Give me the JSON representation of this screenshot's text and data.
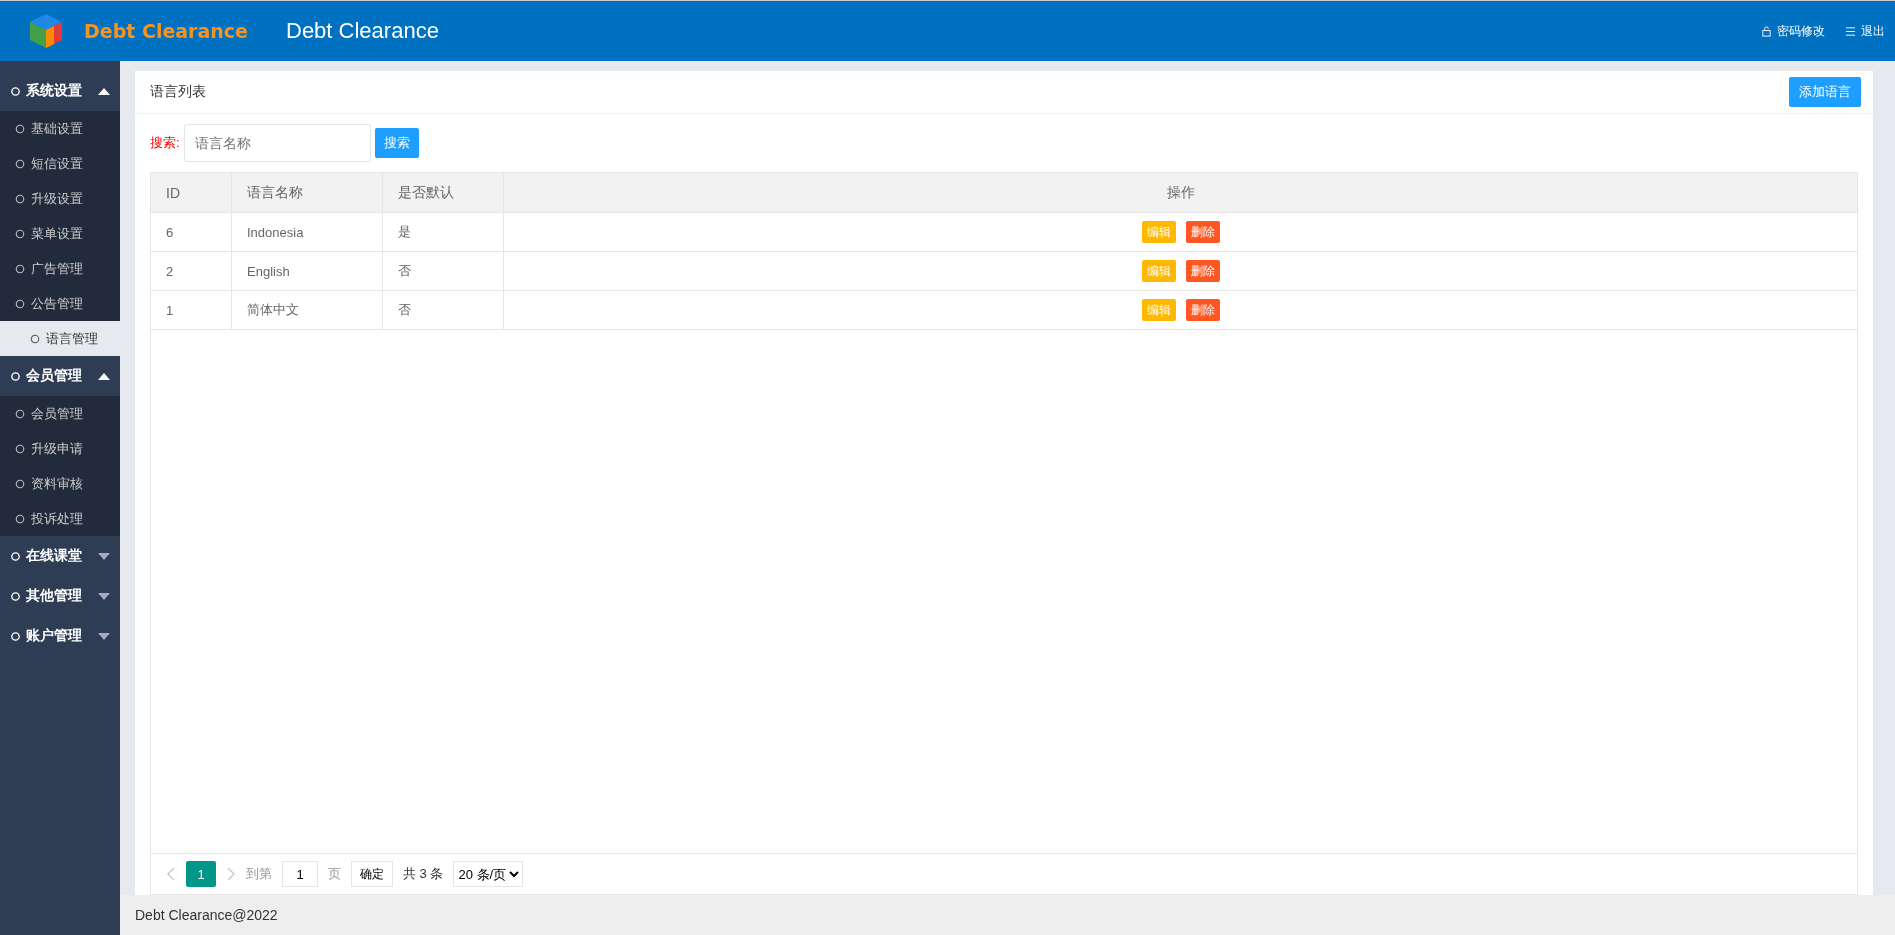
{
  "header": {
    "logo_text": "Debt Clearance",
    "title": "Debt Clearance",
    "links": [
      "密码修改",
      "退出"
    ]
  },
  "sidebar": {
    "groups": [
      {
        "label": "系统设置",
        "expanded": true,
        "items": [
          {
            "label": "基础设置",
            "selected": false
          },
          {
            "label": "短信设置",
            "selected": false
          },
          {
            "label": "升级设置",
            "selected": false
          },
          {
            "label": "菜单设置",
            "selected": false
          },
          {
            "label": "广告管理",
            "selected": false
          },
          {
            "label": "公告管理",
            "selected": false
          },
          {
            "label": "语言管理",
            "selected": true
          }
        ]
      },
      {
        "label": "会员管理",
        "expanded": true,
        "items": [
          {
            "label": "会员管理",
            "selected": false
          },
          {
            "label": "升级申请",
            "selected": false
          },
          {
            "label": "资料审核",
            "selected": false
          },
          {
            "label": "投诉处理",
            "selected": false
          }
        ]
      },
      {
        "label": "在线课堂",
        "expanded": false
      },
      {
        "label": "其他管理",
        "expanded": false
      },
      {
        "label": "账户管理",
        "expanded": false
      }
    ]
  },
  "panel": {
    "title": "语言列表",
    "add_button": "添加语言"
  },
  "search": {
    "label": "搜索:",
    "placeholder": "语言名称",
    "button": "搜索"
  },
  "table": {
    "columns": [
      "ID",
      "语言名称",
      "是否默认",
      "操作"
    ],
    "rows": [
      {
        "cells": [
          "6",
          "Indonesia",
          "是"
        ],
        "actions": [
          {
            "label": "编辑",
            "kind": "edit"
          },
          {
            "label": "删除",
            "kind": "delete"
          }
        ]
      },
      {
        "cells": [
          "2",
          "English",
          "否"
        ],
        "actions": [
          {
            "label": "编辑",
            "kind": "edit"
          },
          {
            "label": "删除",
            "kind": "delete"
          }
        ]
      },
      {
        "cells": [
          "1",
          "简体中文",
          "否"
        ],
        "actions": [
          {
            "label": "编辑",
            "kind": "edit"
          },
          {
            "label": "删除",
            "kind": "delete"
          }
        ]
      }
    ]
  },
  "pagination": {
    "pages": [
      {
        "label": "1",
        "selected": true
      }
    ],
    "goto_label": "到第",
    "goto_value": "1",
    "page_unit": "页",
    "confirm": "确定",
    "total": "共 3 条",
    "page_size": "20 条/页"
  },
  "footer": "Debt Clearance@2022"
}
